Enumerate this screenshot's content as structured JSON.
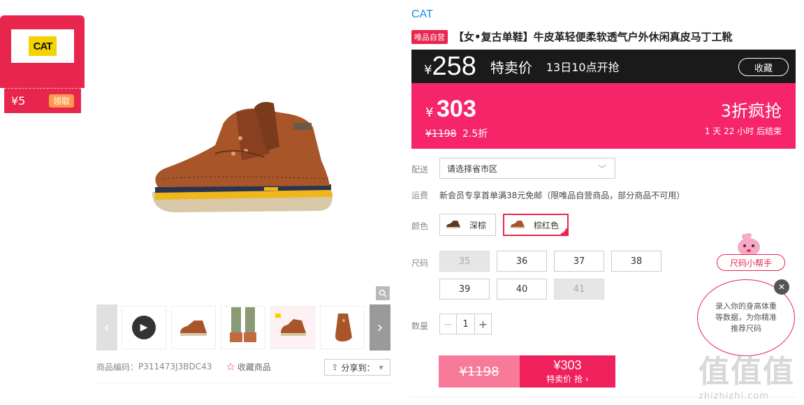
{
  "coupon": {
    "brand_logo": "CAT",
    "amount": "¥5",
    "get_label": "领取"
  },
  "product": {
    "brand": "CAT",
    "self_badge": "唯品自营",
    "title": "【女•复古单鞋】牛皮革轻便柔软透气户外休闲真皮马丁工靴",
    "code_label": "商品编码：",
    "code": "P311473J3BDC43",
    "fav_label": "收藏商品",
    "share_label": "分享到："
  },
  "price": {
    "currency": "¥",
    "special_price": "258",
    "special_label": "特卖价",
    "start_time": "13日10点开抢",
    "fav_button": "收藏",
    "current_price": "303",
    "original_price": "¥1198",
    "discount": "2.5折",
    "promo": "3折疯抢",
    "countdown": "1 天 22 小时 后结束"
  },
  "delivery": {
    "label": "配送",
    "placeholder": "请选择省市区"
  },
  "shipping": {
    "label": "运费",
    "text": "新会员专享首单满38元免邮（限唯品自营商品，部分商品不可用）"
  },
  "colors": {
    "label": "颜色",
    "options": [
      {
        "label": "深棕",
        "swatch": "#5a3a24",
        "selected": false
      },
      {
        "label": "棕红色",
        "swatch": "#a8552a",
        "selected": true
      }
    ]
  },
  "sizes": {
    "label": "尺码",
    "options": [
      {
        "label": "35",
        "available": false
      },
      {
        "label": "36",
        "available": true
      },
      {
        "label": "37",
        "available": true
      },
      {
        "label": "38",
        "available": true
      },
      {
        "label": "39",
        "available": true
      },
      {
        "label": "40",
        "available": true
      },
      {
        "label": "41",
        "available": false
      }
    ]
  },
  "quantity": {
    "label": "数量",
    "value": "1",
    "minus": "−",
    "plus": "+"
  },
  "buy": {
    "original": "¥1198",
    "price": "¥303",
    "action": "特卖价 抢"
  },
  "helper": {
    "pill": "尺码小帮手",
    "bubble": "录入你的身高体重等数据，为你精准推荐尺码"
  },
  "watermark": {
    "big": "值值值",
    "small": "zhizhizhi.com"
  },
  "colors_theme": {
    "accent": "#e8264d",
    "hot": "#f6256a",
    "dark": "#1a1a1a",
    "link": "#1e88e5"
  }
}
